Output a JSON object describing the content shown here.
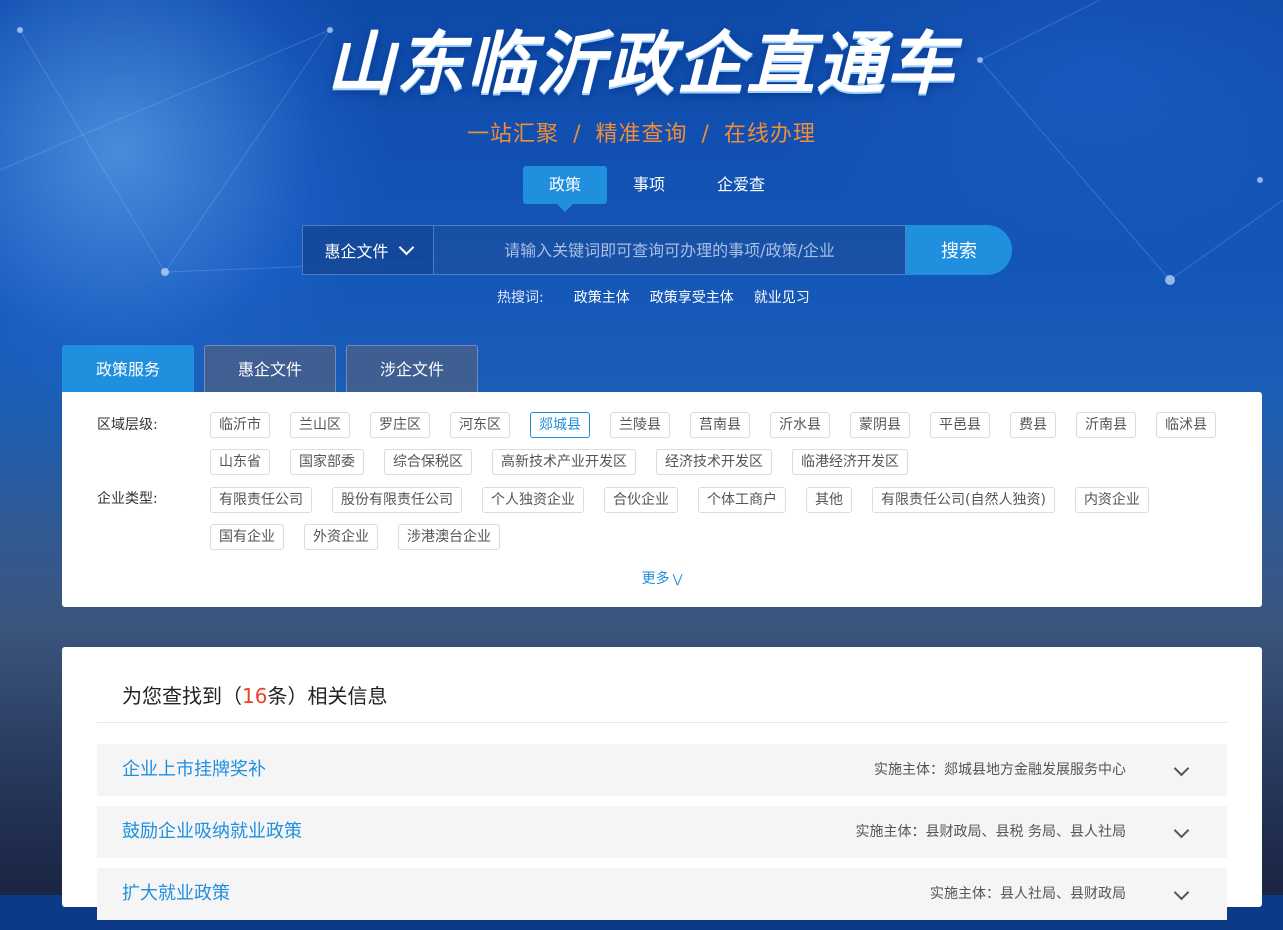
{
  "hero": {
    "title": "山东临沂政企直通车",
    "subtitle_parts": [
      "一站汇聚",
      "精准查询",
      "在线办理"
    ],
    "subtitle_sep": "/"
  },
  "top_tabs": [
    "政策",
    "事项",
    "企爱查"
  ],
  "search": {
    "select_label": "惠企文件",
    "placeholder": "请输入关键词即可查询可办理的事项/政策/企业",
    "button_label": "搜索"
  },
  "hot": {
    "label": "热搜词:",
    "words": [
      "政策主体",
      "政策享受主体",
      "就业见习"
    ]
  },
  "panel_tabs": [
    "政策服务",
    "惠企文件",
    "涉企文件"
  ],
  "filters": {
    "region": {
      "label": "区域层级:",
      "options": [
        "临沂市",
        "兰山区",
        "罗庄区",
        "河东区",
        "郯城县",
        "兰陵县",
        "莒南县",
        "沂水县",
        "蒙阴县",
        "平邑县",
        "费县",
        "沂南县",
        "临沭县",
        "山东省",
        "国家部委",
        "综合保税区",
        "高新技术产业开发区",
        "经济技术开发区",
        "临港经济开发区"
      ],
      "selected": "郯城县"
    },
    "enterprise": {
      "label": "企业类型:",
      "options": [
        "有限责任公司",
        "股份有限责任公司",
        "个人独资企业",
        "合伙企业",
        "个体工商户",
        "其他",
        "有限责任公司(自然人独资)",
        "内资企业",
        "国有企业",
        "外资企业",
        "涉港澳台企业"
      ]
    },
    "more_label": "更多"
  },
  "results": {
    "prefix": "为您查找到（",
    "count": "16",
    "suffix": "条）相关信息",
    "items": [
      {
        "title": "企业上市挂牌奖补",
        "agency": "实施主体：郯城县地方金融发展服务中心"
      },
      {
        "title": "鼓励企业吸纳就业政策",
        "agency": "实施主体：县财政局、县税 务局、县人社局"
      },
      {
        "title": "扩大就业政策",
        "agency": "实施主体：县人社局、县财政局"
      }
    ]
  },
  "colors": {
    "accent": "#1f8fde",
    "orange": "#f08c3a",
    "count_red": "#e8432b"
  }
}
